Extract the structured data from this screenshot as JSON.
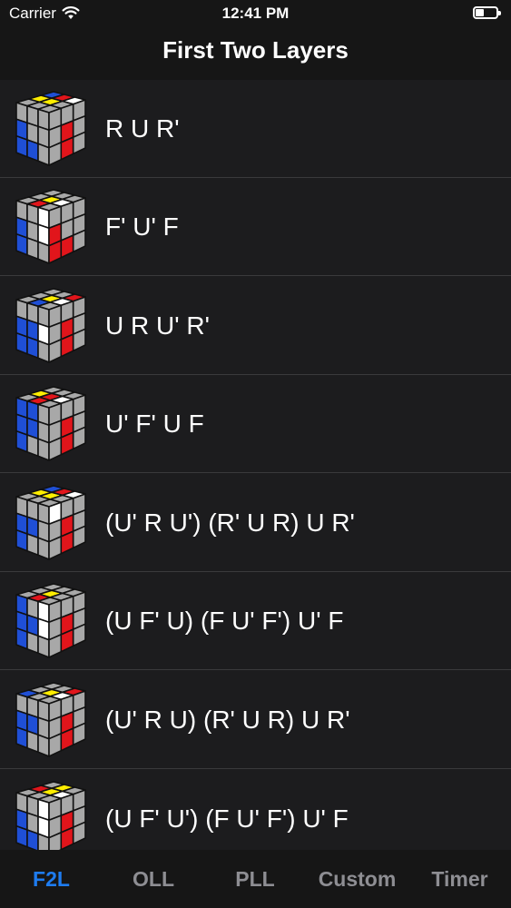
{
  "status": {
    "carrier": "Carrier",
    "time": "12:41 PM",
    "battery_level": 0.38
  },
  "header": {
    "title": "First Two Layers"
  },
  "algorithms": [
    "R U R'",
    "F' U' F",
    "U R U' R'",
    "U' F' U F",
    "(U' R U') (R' U R) U R'",
    "(U F' U) (F U' F') U' F",
    "(U' R U) (R' U R) U R'",
    "(U F' U') (F U' F') U' F"
  ],
  "tabs": [
    {
      "label": "F2L",
      "active": true
    },
    {
      "label": "OLL",
      "active": false
    },
    {
      "label": "PLL",
      "active": false
    },
    {
      "label": "Custom",
      "active": false
    },
    {
      "label": "Timer",
      "active": false
    }
  ],
  "colors": {
    "accent": "#1e7cf0",
    "background": "#1c1c1e",
    "cube_gray": "#a8a8a8",
    "cube_yellow": "#ffee00",
    "cube_red": "#e1151b",
    "cube_blue": "#1f4fd6",
    "cube_white": "#ffffff"
  }
}
